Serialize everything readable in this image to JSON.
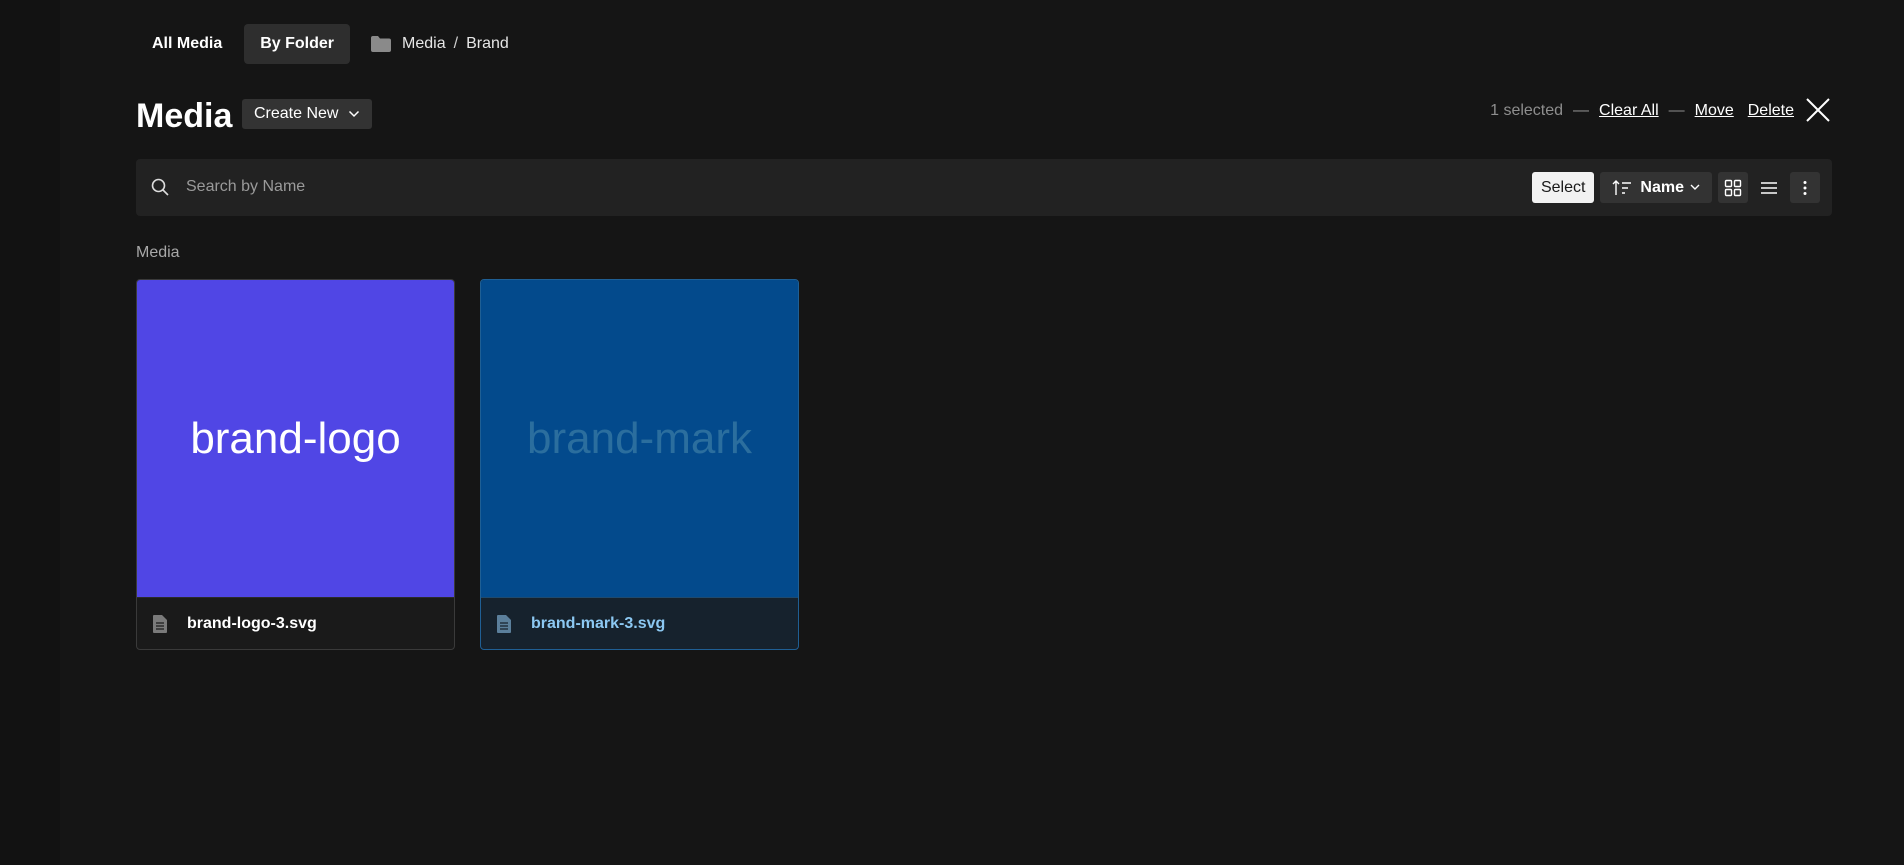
{
  "nav": {
    "tabs": [
      {
        "label": "All Media",
        "active": false
      },
      {
        "label": "By Folder",
        "active": true
      }
    ],
    "breadcrumb": [
      "Media",
      "Brand"
    ],
    "breadcrumb_separator": "/"
  },
  "header": {
    "title": "Media",
    "create_label": "Create New",
    "selection": {
      "count_text": "1 selected",
      "dash": "—",
      "clear_all": "Clear All",
      "move": "Move",
      "delete": "Delete"
    }
  },
  "toolbar": {
    "search_placeholder": "Search by Name",
    "search_value": "",
    "select_label": "Select",
    "sort_label": "Name"
  },
  "section": {
    "label": "Media"
  },
  "items": [
    {
      "thumb_text": "brand-logo",
      "filename": "brand-logo-3.svg",
      "thumb_bg": "#5046e5",
      "thumb_fg": "#ffffff",
      "selected": false
    },
    {
      "thumb_text": "brand-mark",
      "filename": "brand-mark-3.svg",
      "thumb_bg": "#034a8c",
      "thumb_fg": "#2b6e9e",
      "selected": true
    }
  ],
  "colors": {
    "background": "#151515",
    "toolbar": "#222222",
    "selected_border": "#1f5f94",
    "selected_text": "#8cc8f2"
  },
  "icons": [
    "folder-icon",
    "chevron-down-icon",
    "close-icon",
    "search-icon",
    "sort-icon",
    "grid-view-icon",
    "list-view-icon",
    "more-vertical-icon",
    "file-icon"
  ]
}
